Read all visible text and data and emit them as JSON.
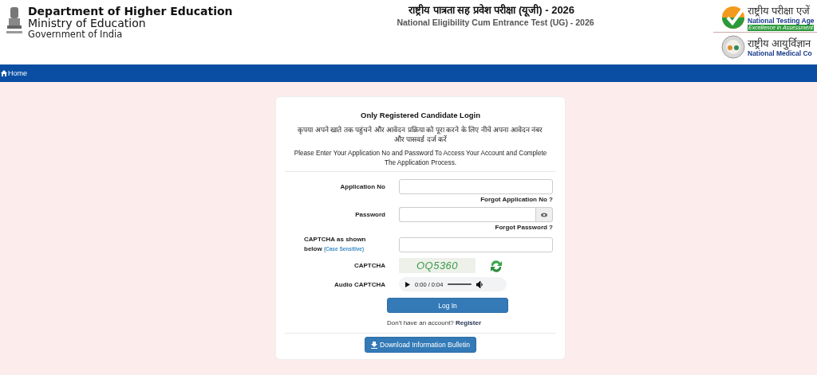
{
  "header": {
    "department": "Department of Higher Education",
    "ministry": "Ministry of Education",
    "government": "Government of India",
    "title_hindi": "राष्ट्रीय पात्रता सह प्रवेश परीक्षा (यूजी) - 2026",
    "title_english": "National Eligibility Cum Entrance Test (UG) - 2026",
    "partners": [
      {
        "kind": "nta",
        "name_hindi": "राष्ट्रीय परीक्षा एजें",
        "name_english": "National Testing Age",
        "tagline": "Excellence in Assessment"
      },
      {
        "kind": "nmc",
        "name_hindi": "राष्ट्रीय आयुर्विज्ञान",
        "name_english": "National Medical Co"
      }
    ]
  },
  "nav": [
    {
      "label": "Home"
    }
  ],
  "login": {
    "title": "Only Registered Candidate Login",
    "hindi_instruction": "कृपया अपने खाते तक पहुंचने और आवेदन प्रक्रिया को पूरा करने के लिए नीचे अपना आवेदन नंबर और पासवर्ड दर्ज करें",
    "instruction": "Please Enter Your Application No and Password To Access Your Account and Complete The Application Process.",
    "rows": [
      {
        "kind": "text",
        "label": "Application No",
        "link": "Forgot Application No ?"
      },
      {
        "kind": "password",
        "label": "Password",
        "link": "Forgot Password ?"
      },
      {
        "kind": "text",
        "label": "CAPTCHA as shown below",
        "note": "(Case Sensitive)"
      },
      {
        "kind": "captcha",
        "label": "CAPTCHA",
        "code": "OQ5360"
      },
      {
        "kind": "audio",
        "label": "Audio CAPTCHA",
        "time": "0:00 / 0:04"
      }
    ],
    "login_button": "Log In",
    "register_prompt": "Don't have an account?",
    "register_link": "Register",
    "download_button": "Download Information Bulletin"
  }
}
